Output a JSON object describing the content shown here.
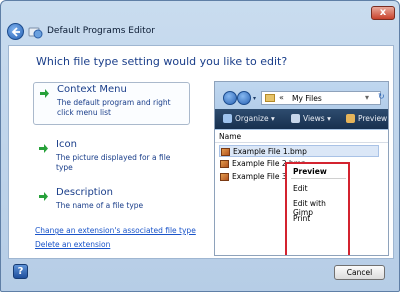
{
  "window": {
    "title": "Default Programs Editor",
    "close_label": "x"
  },
  "heading": "Which file type setting would you like to edit?",
  "options": [
    {
      "title": "Context Menu",
      "description": "The default program and right click menu list"
    },
    {
      "title": "Icon",
      "description": "The picture displayed for a file type"
    },
    {
      "title": "Description",
      "description": "The name of a file type"
    }
  ],
  "links": {
    "change_extension": "Change an extension's associated file type",
    "delete_extension": "Delete an extension"
  },
  "preview": {
    "address_chevron": "«",
    "address": "My Files",
    "toolbar": {
      "organize": "Organize ▾",
      "views": "Views ▾",
      "preview": "Preview"
    },
    "column_header": "Name",
    "files": [
      "Example File 1.bmp",
      "Example File 2.bmp",
      "Example File 3.bmp"
    ],
    "context_menu": [
      "Preview",
      "Edit",
      "Edit with Gimp",
      "Print"
    ]
  },
  "buttons": {
    "help": "?",
    "cancel": "Cancel"
  },
  "colors": {
    "heading": "#1a3e8a",
    "link": "#1a54c9",
    "highlight_border": "#d3232f",
    "arrow_green": "#27a13a"
  }
}
